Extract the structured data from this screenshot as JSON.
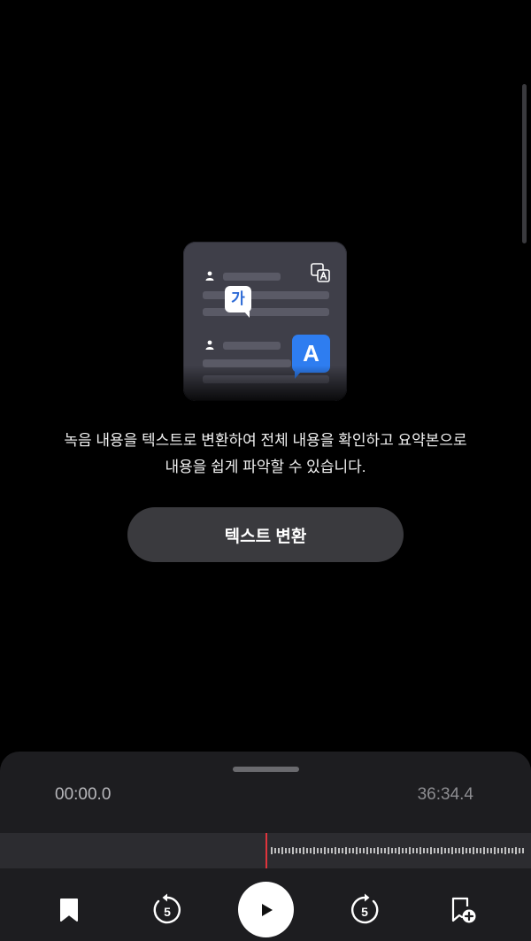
{
  "description": {
    "line1": "녹음 내용을 텍스트로 변환하여 전체 내용을 확인하고 요약본으로",
    "line2": "내용을 쉽게 파악할 수 있습니다."
  },
  "illustration": {
    "badge_korean": "가",
    "badge_english": "A"
  },
  "cta": {
    "label": "텍스트 변환"
  },
  "player": {
    "current_time": "00:00.0",
    "total_time": "36:34.4",
    "playback_progress": 0.0
  },
  "controls": {
    "bookmark_icon": "bookmark-icon",
    "rewind_icon": "rewind-5-icon",
    "rewind_seconds": "5",
    "play_icon": "play-icon",
    "forward_icon": "forward-5-icon",
    "forward_seconds": "5",
    "add_bookmark_icon": "add-bookmark-icon"
  },
  "colors": {
    "background": "#000000",
    "sheet": "#1d1d20",
    "playhead": "#e0343c",
    "accent_blue": "#2e7df0",
    "wave_teal": "#4fd1c5"
  }
}
